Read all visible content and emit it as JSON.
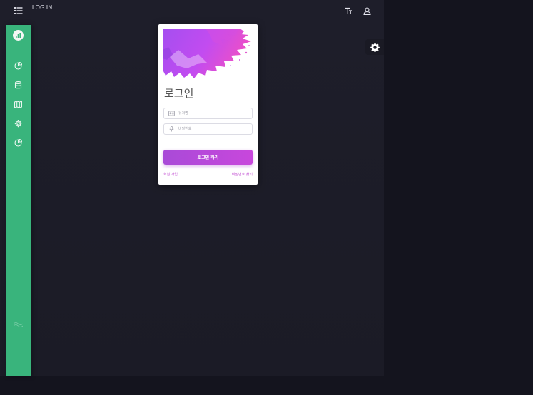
{
  "header": {
    "brand": "LOG IN",
    "icons": {
      "menu": "menu-list-icon",
      "text_size": "text-size-icon",
      "user": "user-icon"
    }
  },
  "sidebar": {
    "logo": "chart-logo-icon",
    "items": [
      {
        "icon": "pie-chart-icon"
      },
      {
        "icon": "database-icon"
      },
      {
        "icon": "map-icon"
      },
      {
        "icon": "gear-icon"
      },
      {
        "icon": "pie-chart-icon"
      }
    ]
  },
  "settings": {
    "icon": "gear-icon"
  },
  "login_card": {
    "title": "로그인",
    "username_placeholder": "유저명",
    "password_placeholder": "비밀번호",
    "submit_label": "로그인 하기",
    "signup_link": "회원 가입",
    "forgot_link": "비밀번호 찾기"
  },
  "colors": {
    "background": "#14141e",
    "app_background": "#1e1e2a",
    "sidebar": "#39b47c",
    "accent": "#c847dc",
    "link": "#c24fd2"
  }
}
